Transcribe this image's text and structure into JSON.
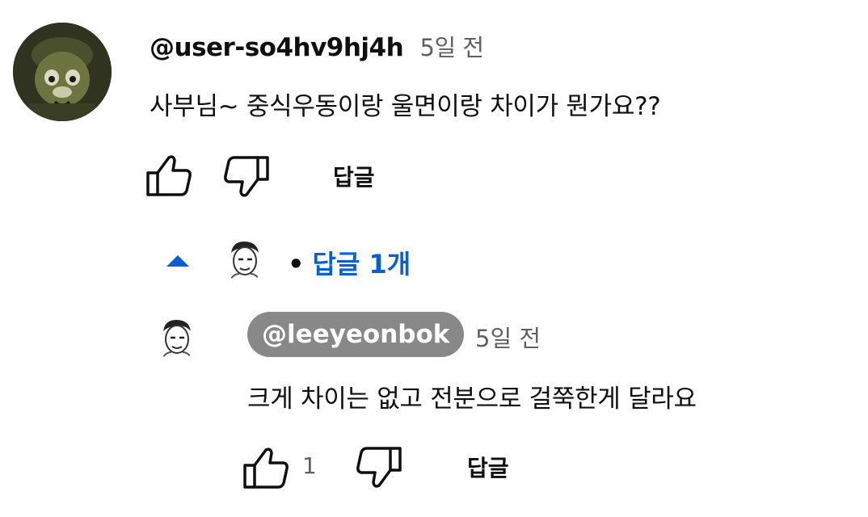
{
  "comment": {
    "author": "@user-so4hv9hj4h",
    "time": "5일 전",
    "text": "사부님~ 중식우동이랑 울면이랑 차이가 뭔가요??",
    "reply_label": "답글"
  },
  "replies_toggle": {
    "bullet": "•",
    "label": "답글 1개"
  },
  "reply": {
    "author": "@leeyeonbok",
    "time": "5일 전",
    "text": "크게 차이는 없고 전분으로 걸쭉한게 달라요",
    "like_count": "1",
    "reply_label": "답글"
  },
  "icons": [
    "like-icon",
    "dislike-icon",
    "collapse-arrow-icon"
  ],
  "colors": {
    "link": "#065fd4",
    "owner_chip": "#888888",
    "muted": "#606060"
  }
}
